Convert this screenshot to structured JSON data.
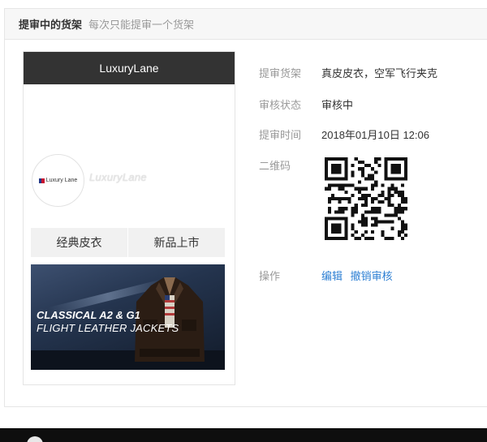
{
  "panel": {
    "title": "提审中的货架",
    "subtitle": "每次只能提审一个货架"
  },
  "preview": {
    "shop_header": "LuxuryLane",
    "logo_text": "Luxury Lane",
    "shop_name": "LuxuryLane",
    "tabs": [
      {
        "label": "经典皮衣"
      },
      {
        "label": "新品上市"
      }
    ],
    "banner": {
      "line1": "CLASSICAL A2 & G1",
      "line2": "FLIGHT LEATHER JACKETS"
    }
  },
  "info": {
    "shelf_label": "提审货架",
    "shelf_value": "真皮皮衣，空军飞行夹克",
    "status_label": "审核状态",
    "status_value": "审核中",
    "time_label": "提审时间",
    "time_value": "2018年01月10日 12:06",
    "qr_label": "二维码",
    "action_label": "操作",
    "actions": [
      {
        "label": "编辑"
      },
      {
        "label": "撤销审核"
      }
    ]
  },
  "colors": {
    "header_bg": "#333333",
    "link": "#2d7fd3",
    "tab_bg": "#f1f1f1"
  },
  "icons": {
    "qr": "qr-code",
    "logo": "luxurylane-logo"
  }
}
